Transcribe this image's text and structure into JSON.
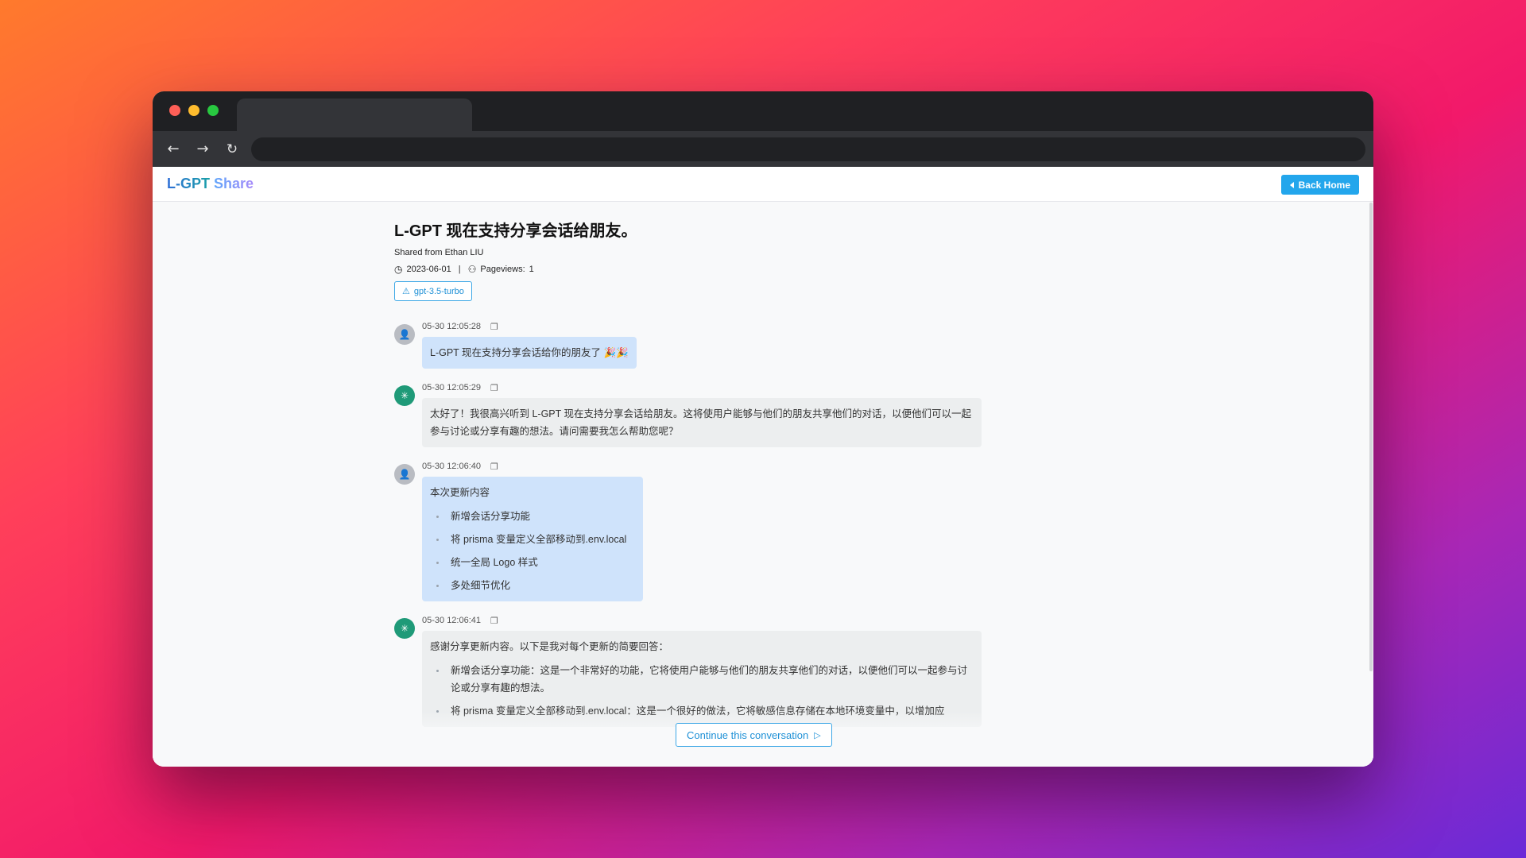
{
  "app": {
    "logo_main": "L-GPT",
    "logo_accent": "Share",
    "back_home_label": "Back Home"
  },
  "conversation": {
    "title": "L-GPT 现在支持分享会话给朋友。",
    "shared_from": "Shared from Ethan LIU",
    "date": "2023-06-01",
    "pageviews_label": "Pageviews:",
    "pageviews_count": "1",
    "model": "gpt-3.5-turbo"
  },
  "messages": [
    {
      "role": "user",
      "time": "05-30 12:05:28",
      "text": "L-GPT 现在支持分享会话给你的朋友了 🎉🎉"
    },
    {
      "role": "assistant",
      "time": "05-30 12:05:29",
      "text": "太好了！我很高兴听到 L-GPT 现在支持分享会话给朋友。这将使用户能够与他们的朋友共享他们的对话，以便他们可以一起参与讨论或分享有趣的想法。请问需要我怎么帮助您呢？"
    },
    {
      "role": "user",
      "time": "05-30 12:06:40",
      "text": "本次更新内容",
      "items": [
        "新增会话分享功能",
        "将 prisma 变量定义全部移动到.env.local",
        "统一全局 Logo 样式",
        "多处细节优化"
      ]
    },
    {
      "role": "assistant",
      "time": "05-30 12:06:41",
      "text": "感谢分享更新内容。以下是我对每个更新的简要回答：",
      "items": [
        "新增会话分享功能：这是一个非常好的功能，它将使用户能够与他们的朋友共享他们的对话，以便他们可以一起参与讨论或分享有趣的想法。",
        "将 prisma 变量定义全部移动到.env.local：这是一个很好的做法，它将敏感信息存储在本地环境变量中，以增加应"
      ]
    }
  ],
  "continue_label": "Continue this conversation",
  "icons": {
    "back": "arrow-left-icon",
    "forward": "arrow-right-icon",
    "reload": "reload-icon",
    "clock": "clock-icon",
    "pageviews": "users-icon",
    "model": "openai-triangle-icon",
    "copy": "copy-icon",
    "continue": "play-forward-icon"
  },
  "colors": {
    "accent": "#23a6ec",
    "user_bubble": "#cfe3fb",
    "assistant_bubble": "#eceeef",
    "assistant_avatar": "#1f9a78"
  }
}
